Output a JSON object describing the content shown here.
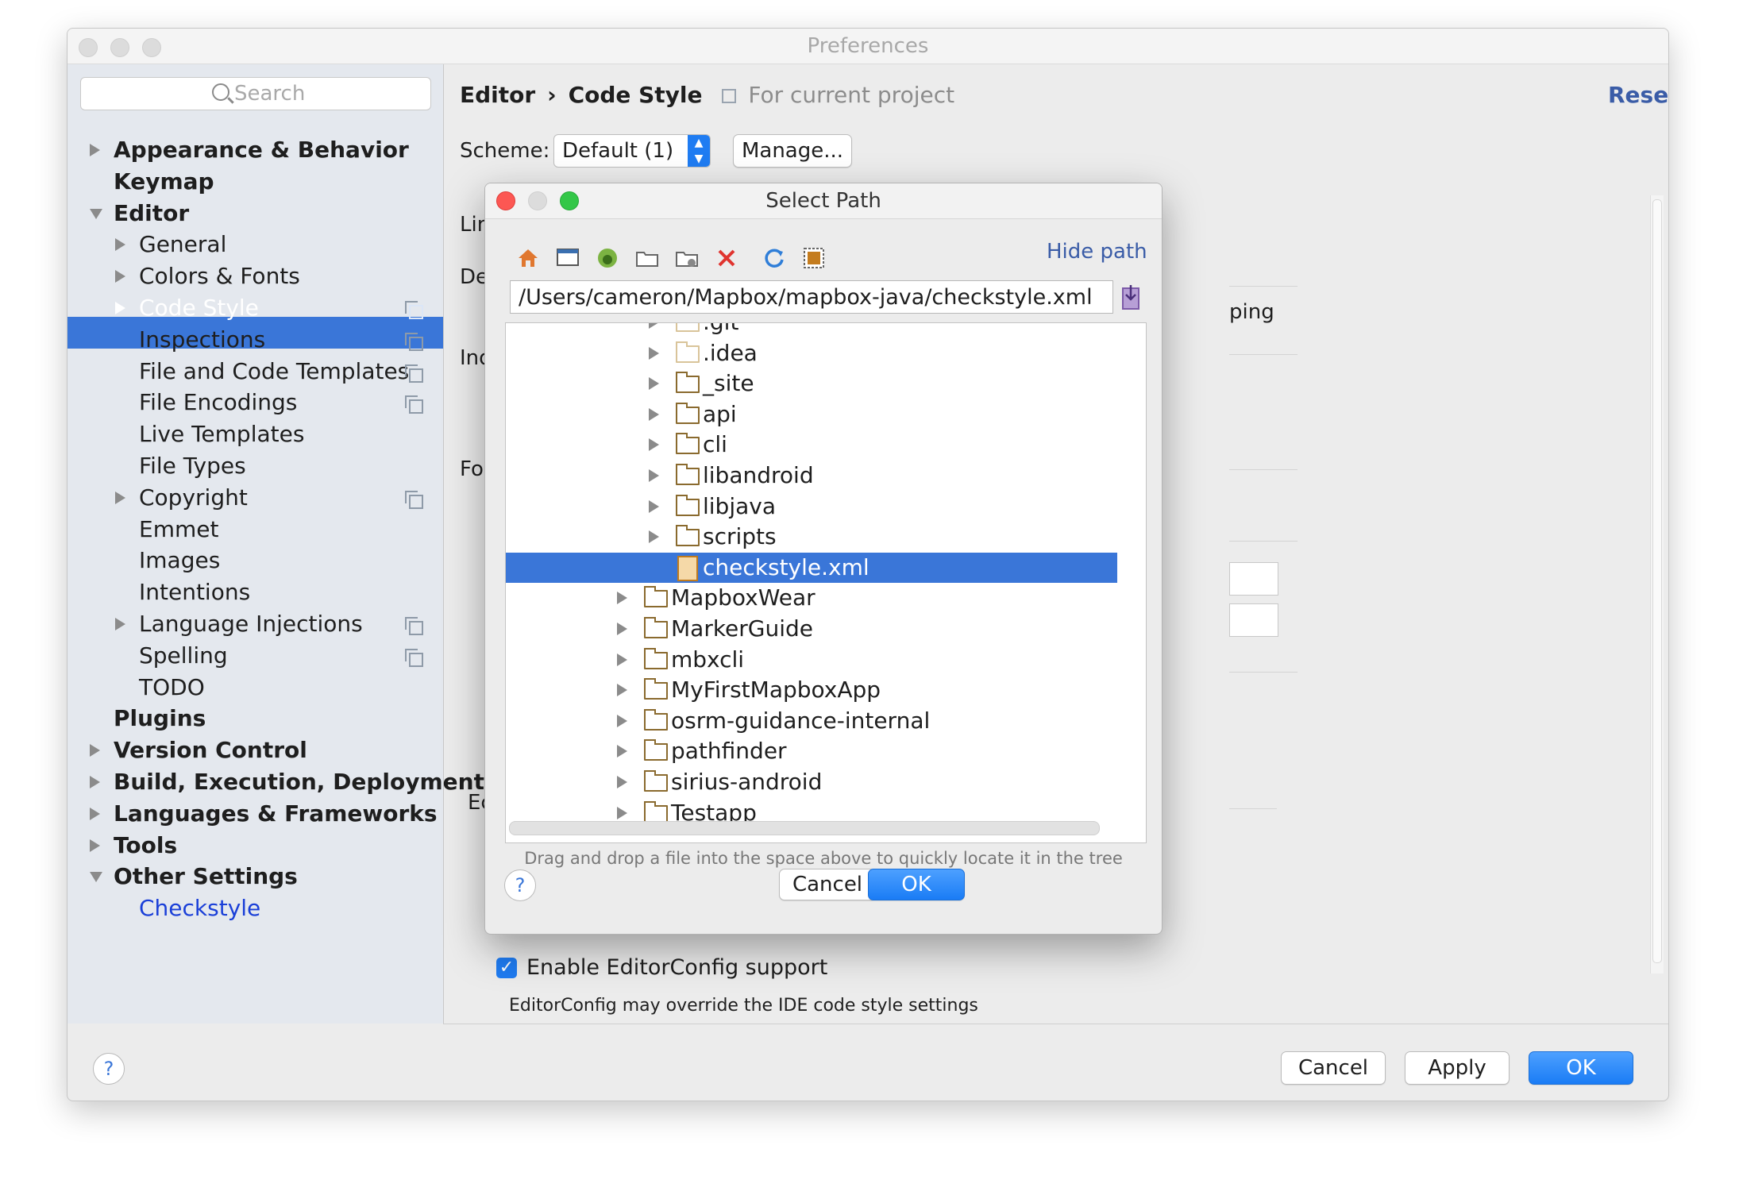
{
  "window": {
    "title": "Preferences"
  },
  "sidebar": {
    "search_placeholder": "Search",
    "items": [
      {
        "label": "Appearance & Behavior",
        "level": 0,
        "expander": "collapsed"
      },
      {
        "label": "Keymap",
        "level": 0,
        "expander": "none"
      },
      {
        "label": "Editor",
        "level": 0,
        "expander": "expanded"
      },
      {
        "label": "General",
        "level": 1,
        "expander": "collapsed"
      },
      {
        "label": "Colors & Fonts",
        "level": 1,
        "expander": "collapsed"
      },
      {
        "label": "Code Style",
        "level": 1,
        "expander": "collapsed",
        "selected": true,
        "project_icon": true
      },
      {
        "label": "Inspections",
        "level": 1,
        "expander": "none",
        "project_icon": true
      },
      {
        "label": "File and Code Templates",
        "level": 1,
        "expander": "none",
        "project_icon": true
      },
      {
        "label": "File Encodings",
        "level": 1,
        "expander": "none",
        "project_icon": true
      },
      {
        "label": "Live Templates",
        "level": 1,
        "expander": "none"
      },
      {
        "label": "File Types",
        "level": 1,
        "expander": "none"
      },
      {
        "label": "Copyright",
        "level": 1,
        "expander": "collapsed",
        "project_icon": true
      },
      {
        "label": "Emmet",
        "level": 1,
        "expander": "none"
      },
      {
        "label": "Images",
        "level": 1,
        "expander": "none"
      },
      {
        "label": "Intentions",
        "level": 1,
        "expander": "none"
      },
      {
        "label": "Language Injections",
        "level": 1,
        "expander": "collapsed",
        "project_icon": true
      },
      {
        "label": "Spelling",
        "level": 1,
        "expander": "none",
        "project_icon": true
      },
      {
        "label": "TODO",
        "level": 1,
        "expander": "none"
      },
      {
        "label": "Plugins",
        "level": 0,
        "expander": "none"
      },
      {
        "label": "Version Control",
        "level": 0,
        "expander": "collapsed"
      },
      {
        "label": "Build, Execution, Deployment",
        "level": 0,
        "expander": "collapsed"
      },
      {
        "label": "Languages & Frameworks",
        "level": 0,
        "expander": "collapsed"
      },
      {
        "label": "Tools",
        "level": 0,
        "expander": "collapsed"
      },
      {
        "label": "Other Settings",
        "level": 0,
        "expander": "expanded"
      },
      {
        "label": "Checkstyle",
        "level": 1,
        "expander": "none",
        "link": true
      }
    ]
  },
  "main": {
    "breadcrumb": {
      "part1": "Editor",
      "separator": "›",
      "part2": "Code Style",
      "scope": "For current project"
    },
    "reset_label": "Reset",
    "scheme_label": "Scheme:",
    "scheme_value": "Default (1)",
    "manage_label": "Manage...",
    "partial_labels": [
      "Lin",
      "De",
      "Ind",
      "For",
      "Ec"
    ],
    "partial_right": "ping",
    "editorconfig_checkbox": "Enable EditorConfig support",
    "editorconfig_hint": "EditorConfig may override the IDE code style settings"
  },
  "dialog": {
    "title": "Select Path",
    "hide_path": "Hide path",
    "path_value": "/Users/cameron/Mapbox/mapbox-java/checkstyle.xml",
    "toolbar_icons": [
      "home-icon",
      "desktop-icon",
      "android-project-icon",
      "folder-icon",
      "new-folder-icon",
      "delete-icon",
      "refresh-icon",
      "show-hidden-icon"
    ],
    "tree": [
      {
        "label": ".git",
        "indent": 1,
        "kind": "folder-light"
      },
      {
        "label": ".idea",
        "indent": 1,
        "kind": "folder-light"
      },
      {
        "label": "_site",
        "indent": 1,
        "kind": "folder"
      },
      {
        "label": "api",
        "indent": 1,
        "kind": "folder"
      },
      {
        "label": "cli",
        "indent": 1,
        "kind": "folder"
      },
      {
        "label": "libandroid",
        "indent": 1,
        "kind": "folder"
      },
      {
        "label": "libjava",
        "indent": 1,
        "kind": "folder"
      },
      {
        "label": "scripts",
        "indent": 1,
        "kind": "folder"
      },
      {
        "label": "checkstyle.xml",
        "indent": 1,
        "kind": "xml",
        "selected": true
      },
      {
        "label": "MapboxWear",
        "indent": 0,
        "kind": "folder"
      },
      {
        "label": "MarkerGuide",
        "indent": 0,
        "kind": "folder"
      },
      {
        "label": "mbxcli",
        "indent": 0,
        "kind": "folder"
      },
      {
        "label": "MyFirstMapboxApp",
        "indent": 0,
        "kind": "folder"
      },
      {
        "label": "osrm-guidance-internal",
        "indent": 0,
        "kind": "folder"
      },
      {
        "label": "pathfinder",
        "indent": 0,
        "kind": "folder"
      },
      {
        "label": "sirius-android",
        "indent": 0,
        "kind": "folder"
      },
      {
        "label": "Testapp",
        "indent": 0,
        "kind": "folder"
      }
    ],
    "drag_hint": "Drag and drop a file into the space above to quickly locate it in the tree",
    "cancel_label": "Cancel",
    "ok_label": "OK",
    "help_label": "?"
  },
  "footer": {
    "help_label": "?",
    "cancel_label": "Cancel",
    "apply_label": "Apply",
    "ok_label": "OK"
  },
  "colors": {
    "selection": "#3a76d8",
    "link": "#1a3fd8",
    "accent_button": "#1a7cf5",
    "close_red": "#fc5753",
    "minimize_gray": "#dcdcdc",
    "zoom_green": "#33c748"
  }
}
